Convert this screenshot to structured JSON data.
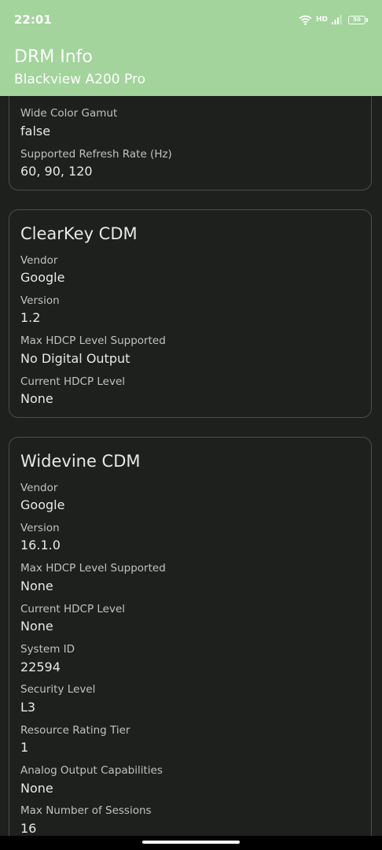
{
  "status_bar": {
    "time": "22:01",
    "hd_label": "HD",
    "battery_level": "50"
  },
  "header": {
    "title": "DRM Info",
    "subtitle": "Blackview A200 Pro"
  },
  "display_card": {
    "fields": [
      {
        "label": "Wide Color Gamut",
        "value": "false"
      },
      {
        "label": "Supported Refresh Rate (Hz)",
        "value": "60, 90, 120"
      }
    ]
  },
  "clearkey_card": {
    "title": "ClearKey CDM",
    "fields": [
      {
        "label": "Vendor",
        "value": "Google"
      },
      {
        "label": "Version",
        "value": "1.2"
      },
      {
        "label": "Max HDCP Level Supported",
        "value": "No Digital Output"
      },
      {
        "label": "Current HDCP Level",
        "value": "None"
      }
    ]
  },
  "widevine_card": {
    "title": "Widevine CDM",
    "fields": [
      {
        "label": "Vendor",
        "value": "Google"
      },
      {
        "label": "Version",
        "value": "16.1.0"
      },
      {
        "label": "Max HDCP Level Supported",
        "value": "None"
      },
      {
        "label": "Current HDCP Level",
        "value": "None"
      },
      {
        "label": "System ID",
        "value": "22594"
      },
      {
        "label": "Security Level",
        "value": "L3"
      },
      {
        "label": "Resource Rating Tier",
        "value": "1"
      },
      {
        "label": "Analog Output Capabilities",
        "value": "None"
      },
      {
        "label": "Max Number of Sessions",
        "value": "16"
      }
    ]
  }
}
